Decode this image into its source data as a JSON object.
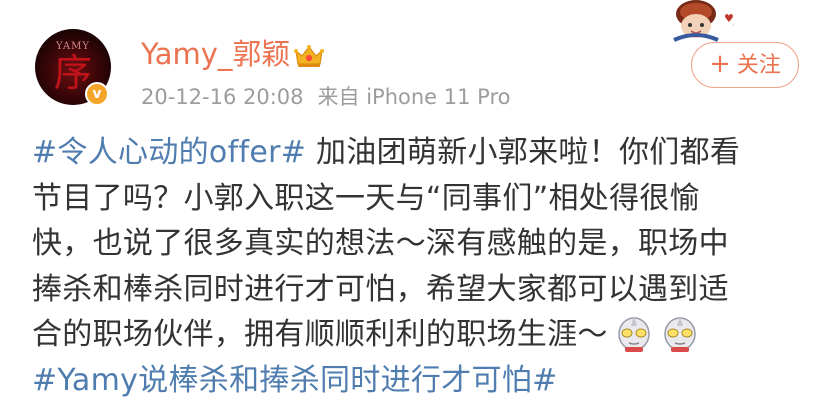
{
  "user": {
    "name": "Yamy_郭颖",
    "avatar_brand": "YAMY",
    "avatar_glyph": "序",
    "verified": true
  },
  "meta": {
    "timestamp": "20-12-16 20:08",
    "source": "来自 iPhone 11 Pro"
  },
  "follow_button": {
    "icon": "+",
    "label": "关注"
  },
  "post": {
    "lines": [
      {
        "hashtag": "#令人心动的offer#",
        "text": " 加油团萌新小郭来啦！你们都看"
      },
      {
        "text": "节目了吗？小郭入职这一天与“同事们”相处得很愉"
      },
      {
        "text": "快，也说了很多真实的想法～深有感触的是，职场中"
      },
      {
        "text": "捧杀和棒杀同时进行才可怕，希望大家都可以遇到适"
      },
      {
        "text": "合的职场伙伴，拥有顺顺利利的职场生涯～"
      },
      {
        "hashtag": "#Yamy说棒杀和捧杀同时进行才可怕#"
      }
    ],
    "emojis": [
      "ultraman-icon",
      "ultraman-icon"
    ]
  },
  "colors": {
    "username": "#eb7350",
    "hashtag": "#507daf",
    "body_text": "#333333",
    "meta_text": "#9c9c9c",
    "follow_border": "#f0a58a"
  }
}
